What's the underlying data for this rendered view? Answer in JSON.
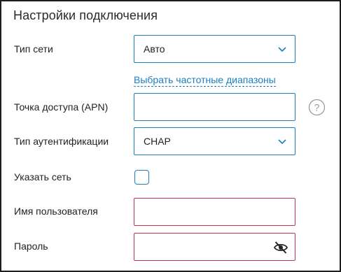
{
  "section": {
    "title": "Настройки подключения"
  },
  "fields": {
    "network_type": {
      "label": "Тип сети",
      "value": "Авто"
    },
    "frequency_link": "Выбрать частотные диапазоны",
    "apn": {
      "label": "Точка доступа (APN)",
      "value": ""
    },
    "auth_type": {
      "label": "Тип аутентификации",
      "value": "CHAP"
    },
    "specify_network": {
      "label": "Указать сеть",
      "checked": false
    },
    "username": {
      "label": "Имя пользователя",
      "value": ""
    },
    "password": {
      "label": "Пароль",
      "value": ""
    }
  },
  "icons": {
    "dropdown": "chevron-down-icon",
    "help": "question-circle-icon",
    "password_toggle": "eye-off-icon"
  },
  "colors": {
    "accent": "#1a7fc1",
    "error": "#c0324a",
    "frame": "#1d1d1d"
  }
}
